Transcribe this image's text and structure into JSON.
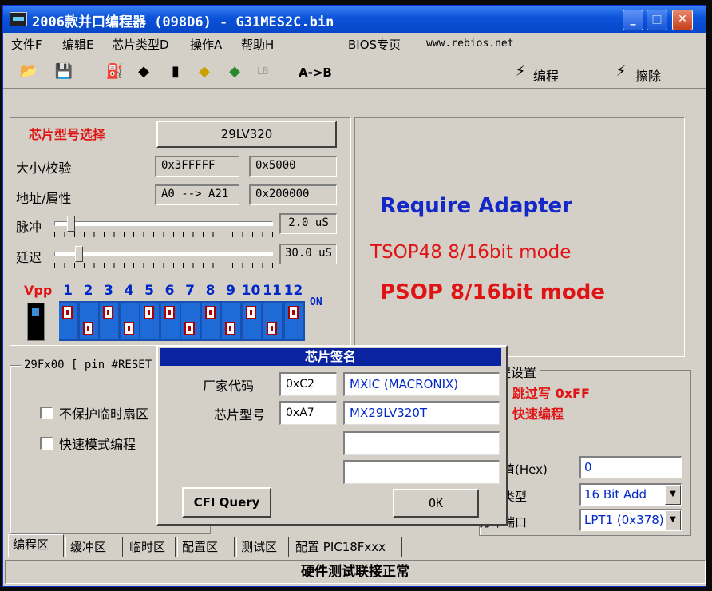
{
  "window": {
    "title": "2006款并口编程器 (098D6) - G31MES2C.bin"
  },
  "menu": {
    "file": "文件F",
    "edit": "编辑E",
    "chip_type": "芯片类型D",
    "operate": "操作A",
    "help": "帮助H",
    "bios": "BIOS专页",
    "site": "www.rebios.net"
  },
  "toolbar": {
    "open_icon": "open-folder-icon",
    "save_icon": "save-disk-icon",
    "lb": "LB",
    "a_to_b": "A->B",
    "program": "编程",
    "erase": "擦除"
  },
  "chip": {
    "select_label": "芯片型号选择",
    "model": "29LV320",
    "size_label": "大小/校验",
    "size": "0x3FFFFF",
    "checksum": "0x5000",
    "addr_label": "地址/属性",
    "addr_range": "A0 --> A21",
    "attr": "0x200000",
    "pulse_label": "脉冲",
    "pulse_value": "2.0 uS",
    "pulse_level": 0.06,
    "delay_label": "延迟",
    "delay_value": "30.0 uS",
    "delay_level": 0.1
  },
  "dip": {
    "vpp": "Vpp",
    "on": "ON",
    "pins": [
      "1",
      "2",
      "3",
      "4",
      "5",
      "6",
      "7",
      "8",
      "9",
      "10",
      "11",
      "12"
    ],
    "states": [
      "up",
      "down",
      "up",
      "down",
      "up",
      "up",
      "down",
      "up",
      "down",
      "up",
      "down",
      "up"
    ]
  },
  "info": {
    "line1": "Require Adapter",
    "line2": "TSOP48 8/16bit mode",
    "line3": "PSOP 8/16bit mode",
    "colors": {
      "line1": "#1428c8",
      "line2": "#e01414",
      "line3": "#e01414"
    }
  },
  "left_group": {
    "title": "29Fx00 [ pin #RESET ]",
    "opt1": "不保护临时扇区",
    "opt2": "快速模式编程"
  },
  "right_group": {
    "title": "编程设置",
    "skip": "跳过写 0xFF",
    "fast": "快速编程",
    "offset_label": "偏移值(Hex)",
    "offset_value": "0",
    "check_label": "校验类型",
    "check_value": "16 Bit Add",
    "port_label": "打印端口",
    "port_value": "LPT1 (0x378)"
  },
  "dialog": {
    "title": "芯片签名",
    "mfr_label": "厂家代码",
    "mfr_code": "0xC2",
    "mfr_name": "MXIC (MACRONIX)",
    "dev_label": "芯片型号",
    "dev_code": "0xA7",
    "dev_name": "MX29LV320T",
    "cfi": "CFI Query",
    "ok": "OK"
  },
  "tabs": [
    "编程区",
    "缓冲区",
    "临时区",
    "配置区",
    "测试区",
    "配置 PIC18Fxxx"
  ],
  "status": "硬件测试联接正常"
}
